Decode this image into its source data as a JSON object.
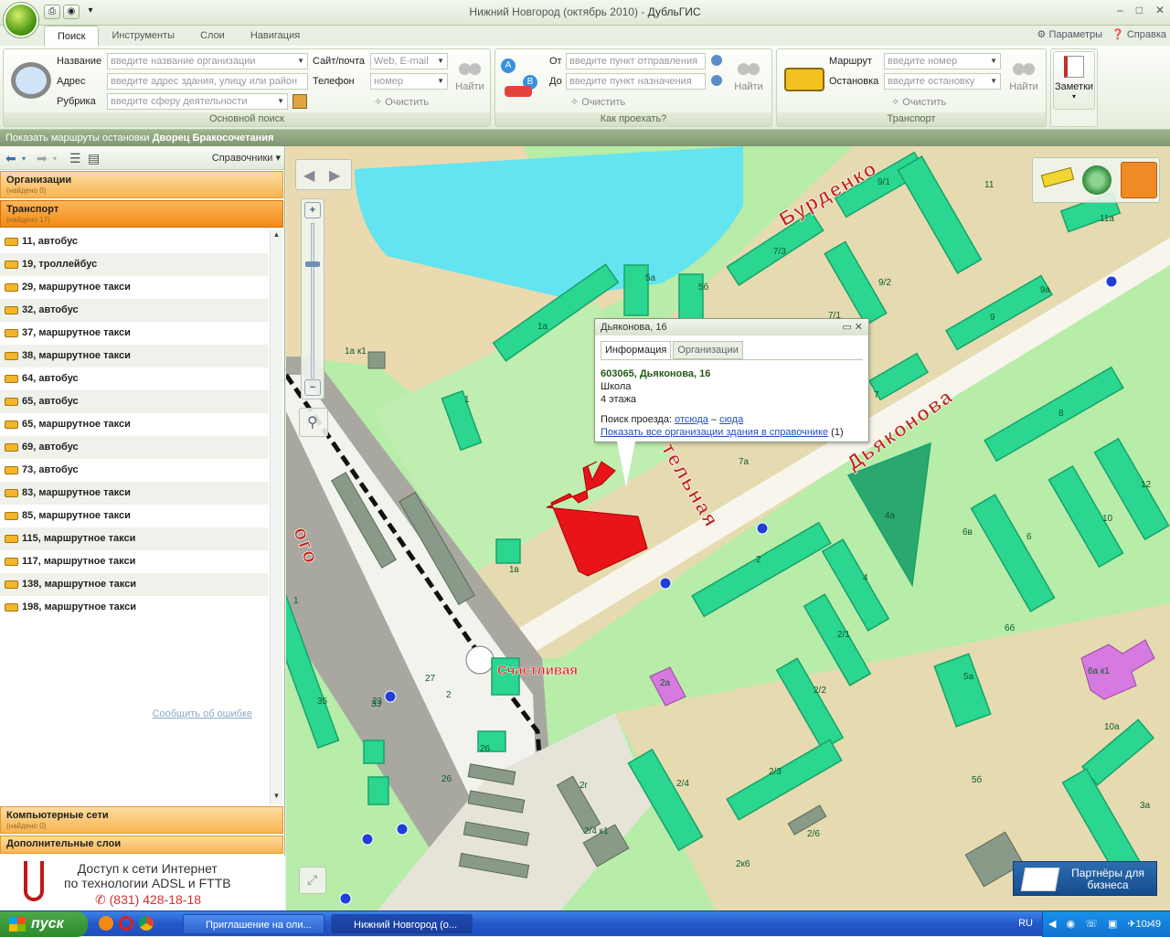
{
  "window": {
    "title_part1": "Нижний Новгород (октябрь 2010)",
    "title_sep": " - ",
    "title_app": "ДубльГИС",
    "min": "–",
    "max": "□",
    "close": "✕"
  },
  "tabs": [
    {
      "label": "Поиск"
    },
    {
      "label": "Инструменты"
    },
    {
      "label": "Слои"
    },
    {
      "label": "Навигация"
    }
  ],
  "toplinks": {
    "params": "Параметры",
    "help": "Справка"
  },
  "search": {
    "name_label": "Название",
    "name_ph": "введите название организации",
    "address_label": "Адрес",
    "address_ph": "введите адрес здания, улицу или район",
    "rubric_label": "Рубрика",
    "rubric_ph": "введите сферу деятельности",
    "site_label": "Сайт/почта",
    "site_ph": "Web, E-mail",
    "phone_label": "Телефон",
    "phone_ph": "номер",
    "clear": "Очистить",
    "find": "Найти",
    "caption": "Основной поиск"
  },
  "route": {
    "from_label": "От",
    "from_ph": "введите пункт отправления",
    "to_label": "До",
    "to_ph": "введите пункт назначения",
    "clear": "Очистить",
    "find": "Найти",
    "caption": "Как проехать?"
  },
  "transport": {
    "route_label": "Маршрут",
    "route_ph": "введите номер",
    "stop_label": "Остановка",
    "stop_ph": "введите остановку",
    "clear": "Очистить",
    "find": "Найти",
    "caption": "Транспорт"
  },
  "notes": {
    "label": "Заметки"
  },
  "statusbar": {
    "prefix": "Показать маршруты остановки ",
    "stop": "Дворец Бракосочетания"
  },
  "left": {
    "sprav": "Справочники",
    "cats": [
      {
        "title": "Организации",
        "count": "(найдено 0)"
      },
      {
        "title": "Транспорт",
        "count": "(найдено 17)"
      }
    ],
    "routes": [
      "11, автобус",
      "19, троллейбус",
      "29, маршрутное такси",
      "32, автобус",
      "37, маршрутное такси",
      "38, маршрутное такси",
      "64, автобус",
      "65, автобус",
      "65, маршрутное такси",
      "69, автобус",
      "73, автобус",
      "83, маршрутное такси",
      "85, маршрутное такси",
      "115, маршрутное такси",
      "117, маршрутное такси",
      "138, маршрутное такси",
      "198, маршрутное такси"
    ],
    "report": "Сообщить об ошибке",
    "bottom_cats": [
      {
        "title": "Компьютерные сети",
        "count": "(найдено 0)"
      },
      {
        "title": "Дополнительные слои",
        "count": ""
      }
    ],
    "ad": {
      "line1": "Доступ к сети Интернет",
      "line2": "по технологии ADSL и FTTB",
      "phone": "(831) 428-18-18"
    }
  },
  "map": {
    "streets": {
      "burdenko": "Бурденко",
      "dyakonova": "Дьяконова",
      "telnaya": "тельная",
      "schastlivaya": "Счастливая",
      "ogo": "ого"
    },
    "labels": [
      "1а",
      "1а к1",
      "1",
      "5а",
      "5б",
      "7/3",
      "7/1",
      "9/1",
      "9/2",
      "9",
      "11",
      "11а",
      "9а",
      "7",
      "7а",
      "8",
      "12",
      "10",
      "6",
      "6в",
      "6б",
      "4а",
      "4",
      "2",
      "2/1",
      "2/2",
      "2/3",
      "2/4",
      "2/6",
      "2к6",
      "1в",
      "27",
      "2",
      "35",
      "23",
      "26",
      "26",
      "2г",
      "2/4 к1",
      "2а",
      "5а",
      "6а к1",
      "10а",
      "3а",
      "5б",
      "1",
      "33"
    ],
    "partners": "Партнёры для бизнеса"
  },
  "popup": {
    "title": "Дьяконова, 16",
    "tab_info": "Информация",
    "tab_orgs": "Организации",
    "address": "603065, Дьяконова, 16",
    "type": "Школа",
    "floors": "4 этажа",
    "search_prefix": "Поиск проезда: ",
    "from": "отсюда",
    "dash": " – ",
    "to": "сюда",
    "show_all": "Показать все организации здания в справочнике",
    "show_count": " (1)"
  },
  "taskbar": {
    "start": "пуск",
    "btn1": "Приглашение на оли...",
    "btn2": "Нижний Новгород (о...",
    "lang": "RU",
    "time": "10:49"
  },
  "colors": {
    "building": "#2ad690",
    "building_dark": "#17a36a",
    "selected": "#e8141a",
    "purple": "#d679e0",
    "water": "#63e4f0",
    "grass": "#b7eca9",
    "road": "#f7f5ec",
    "sand": "#ebd9b0",
    "accent": "#f28a14"
  }
}
